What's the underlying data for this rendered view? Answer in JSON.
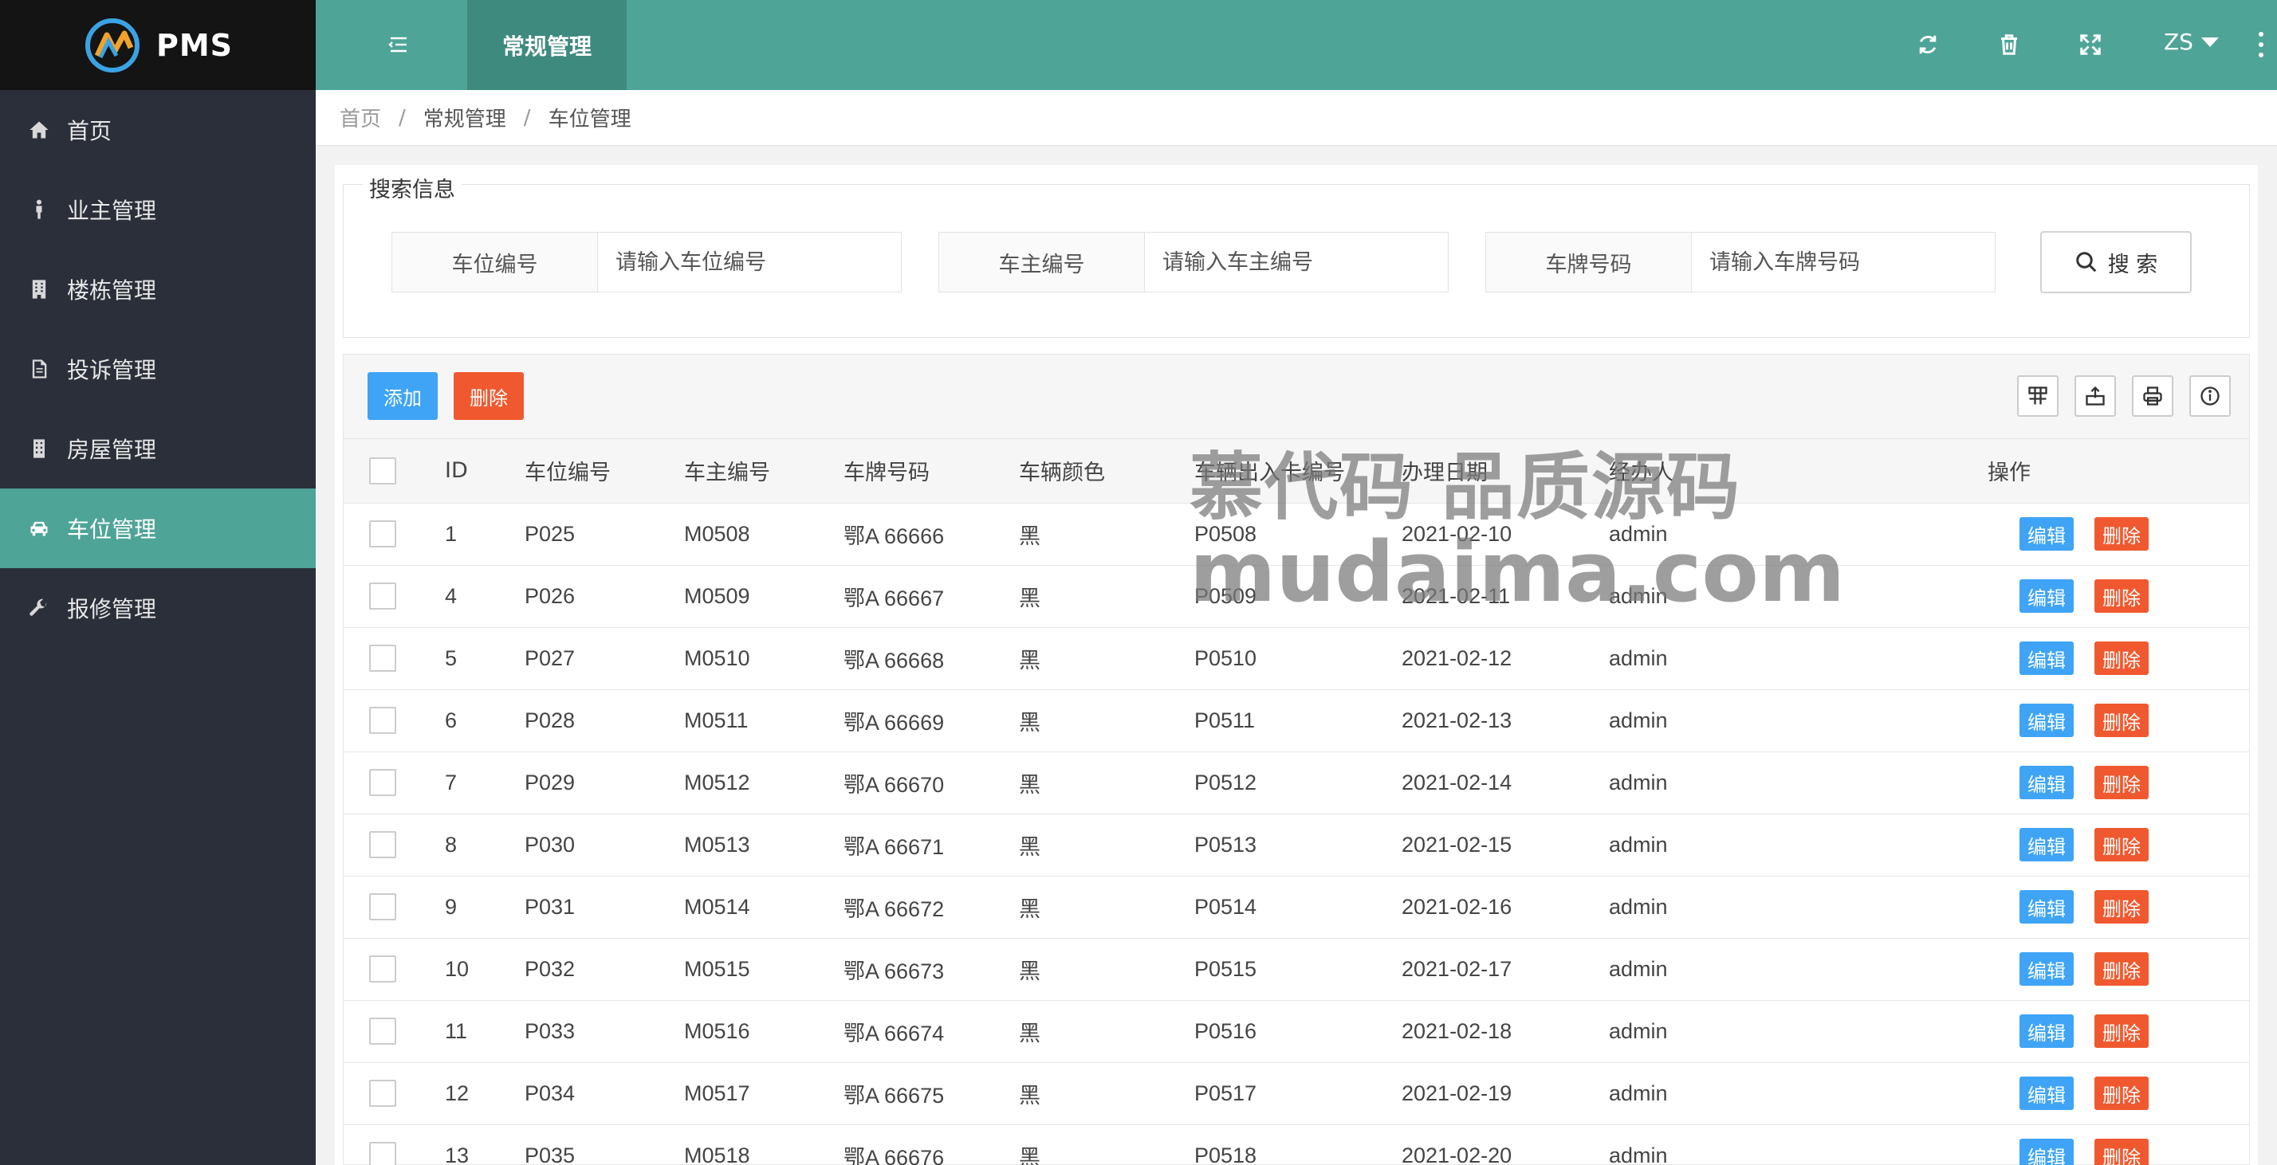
{
  "app": {
    "logo_text": "PMS"
  },
  "sidebar": {
    "items": [
      {
        "label": "首页",
        "icon": "home-icon",
        "active": false
      },
      {
        "label": "业主管理",
        "icon": "person-icon",
        "active": false
      },
      {
        "label": "楼栋管理",
        "icon": "building-icon",
        "active": false
      },
      {
        "label": "投诉管理",
        "icon": "document-icon",
        "active": false
      },
      {
        "label": "房屋管理",
        "icon": "house-icon",
        "active": false
      },
      {
        "label": "车位管理",
        "icon": "car-icon",
        "active": true
      },
      {
        "label": "报修管理",
        "icon": "wrench-icon",
        "active": false
      }
    ]
  },
  "header": {
    "tab_label": "常规管理",
    "user": "ZS",
    "icons": [
      "menu-toggle-icon",
      "refresh-icon",
      "trash-icon",
      "fullscreen-icon",
      "more-icon"
    ]
  },
  "breadcrumb": {
    "home": "首页",
    "section": "常规管理",
    "page": "车位管理"
  },
  "search": {
    "legend": "搜索信息",
    "fields": [
      {
        "label": "车位编号",
        "placeholder": "请输入车位编号"
      },
      {
        "label": "车主编号",
        "placeholder": "请输入车主编号"
      },
      {
        "label": "车牌号码",
        "placeholder": "请输入车牌号码"
      }
    ],
    "button_label": "搜 索"
  },
  "toolbar": {
    "add_label": "添加",
    "delete_label": "删除"
  },
  "table": {
    "columns": [
      "ID",
      "车位编号",
      "车主编号",
      "车牌号码",
      "车辆颜色",
      "车辆出入卡编号",
      "办理日期",
      "经办人",
      "操作"
    ],
    "edit_label": "编辑",
    "delete_label": "删除",
    "rows": [
      [
        "1",
        "P025",
        "M0508",
        "鄂A 66666",
        "黑",
        "P0508",
        "2021-02-10",
        "admin"
      ],
      [
        "4",
        "P026",
        "M0509",
        "鄂A 66667",
        "黑",
        "P0509",
        "2021-02-11",
        "admin"
      ],
      [
        "5",
        "P027",
        "M0510",
        "鄂A 66668",
        "黑",
        "P0510",
        "2021-02-12",
        "admin"
      ],
      [
        "6",
        "P028",
        "M0511",
        "鄂A 66669",
        "黑",
        "P0511",
        "2021-02-13",
        "admin"
      ],
      [
        "7",
        "P029",
        "M0512",
        "鄂A 66670",
        "黑",
        "P0512",
        "2021-02-14",
        "admin"
      ],
      [
        "8",
        "P030",
        "M0513",
        "鄂A 66671",
        "黑",
        "P0513",
        "2021-02-15",
        "admin"
      ],
      [
        "9",
        "P031",
        "M0514",
        "鄂A 66672",
        "黑",
        "P0514",
        "2021-02-16",
        "admin"
      ],
      [
        "10",
        "P032",
        "M0515",
        "鄂A 66673",
        "黑",
        "P0515",
        "2021-02-17",
        "admin"
      ],
      [
        "11",
        "P033",
        "M0516",
        "鄂A 66674",
        "黑",
        "P0516",
        "2021-02-18",
        "admin"
      ],
      [
        "12",
        "P034",
        "M0517",
        "鄂A 66675",
        "黑",
        "P0517",
        "2021-02-19",
        "admin"
      ],
      [
        "13",
        "P035",
        "M0518",
        "鄂A 66676",
        "黑",
        "P0518",
        "2021-02-20",
        "admin"
      ]
    ]
  },
  "watermark": {
    "line1": "慕代码 品质源码",
    "line2": "mudaima.com"
  },
  "colors": {
    "accent": "#4ea497",
    "sidebar_bg": "#2b2f3a",
    "primary_btn": "#3fa4f6",
    "danger_btn": "#f0592f"
  }
}
